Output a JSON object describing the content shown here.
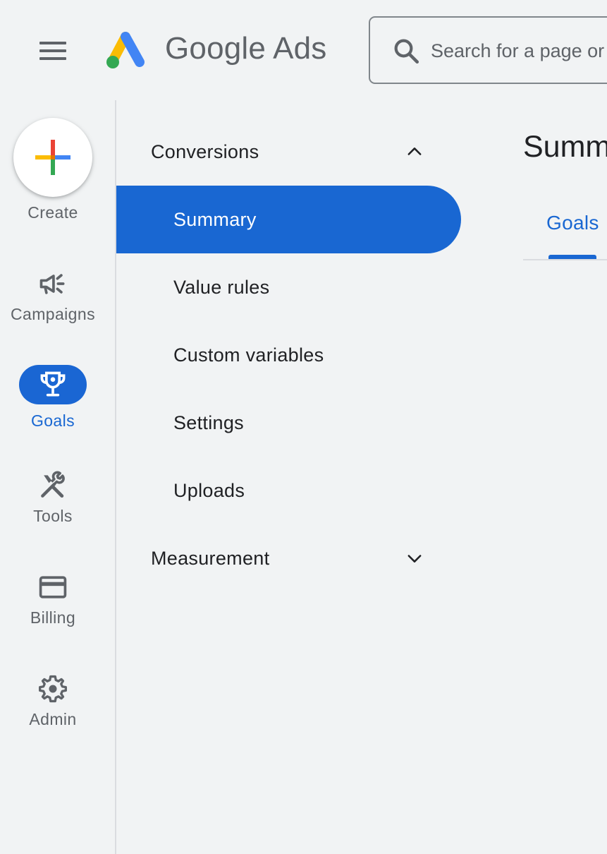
{
  "header": {
    "brand_name": "Google Ads",
    "search_placeholder": "Search for a page or campaign"
  },
  "rail": {
    "create_label": "Create",
    "items": [
      {
        "label": "Campaigns",
        "icon": "megaphone-icon",
        "active": false
      },
      {
        "label": "Goals",
        "icon": "trophy-icon",
        "active": true
      },
      {
        "label": "Tools",
        "icon": "tools-icon",
        "active": false
      },
      {
        "label": "Billing",
        "icon": "credit-card-icon",
        "active": false
      },
      {
        "label": "Admin",
        "icon": "gear-icon",
        "active": false
      }
    ]
  },
  "subnav": {
    "sections": [
      {
        "label": "Conversions",
        "expanded": true,
        "items": [
          {
            "label": "Summary",
            "active": true
          },
          {
            "label": "Value rules",
            "active": false
          },
          {
            "label": "Custom variables",
            "active": false
          },
          {
            "label": "Settings",
            "active": false
          },
          {
            "label": "Uploads",
            "active": false
          }
        ]
      },
      {
        "label": "Measurement",
        "expanded": false
      }
    ]
  },
  "main": {
    "title": "Summary",
    "tabs": [
      {
        "label": "Goals",
        "active": true
      }
    ]
  },
  "colors": {
    "accent": "#1967d2",
    "background": "#f1f3f4",
    "icon_gray": "#5f6368"
  }
}
